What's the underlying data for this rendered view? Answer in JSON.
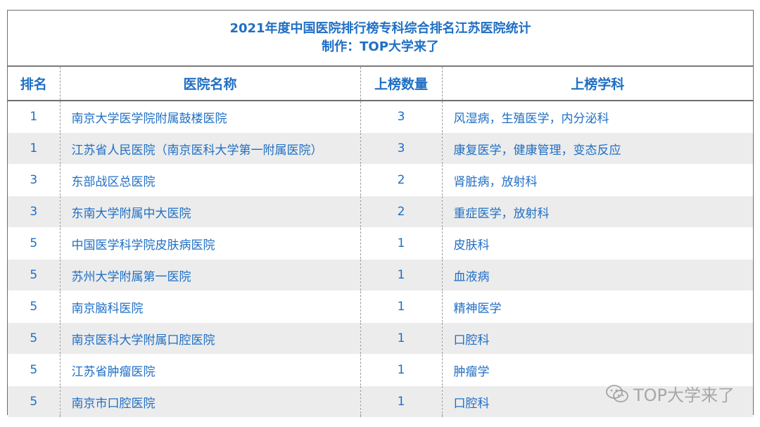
{
  "title": {
    "line1": "2021年度中国医院排行榜专科综合排名江苏医院统计",
    "line2": "制作：TOP大学来了"
  },
  "table": {
    "headers": [
      "排名",
      "医院名称",
      "上榜数量",
      "上榜学科"
    ],
    "rows": [
      {
        "rank": "1",
        "name": "南京大学医学院附属鼓楼医院",
        "count": "3",
        "subjects": "风湿病，生殖医学，内分泌科"
      },
      {
        "rank": "1",
        "name": "江苏省人民医院（南京医科大学第一附属医院）",
        "count": "3",
        "subjects": "康复医学，健康管理，变态反应"
      },
      {
        "rank": "3",
        "name": "东部战区总医院",
        "count": "2",
        "subjects": "肾脏病，放射科"
      },
      {
        "rank": "3",
        "name": "东南大学附属中大医院",
        "count": "2",
        "subjects": "重症医学，放射科"
      },
      {
        "rank": "5",
        "name": "中国医学科学院皮肤病医院",
        "count": "1",
        "subjects": "皮肤科"
      },
      {
        "rank": "5",
        "name": "苏州大学附属第一医院",
        "count": "1",
        "subjects": "血液病"
      },
      {
        "rank": "5",
        "name": "南京脑科医院",
        "count": "1",
        "subjects": "精神医学"
      },
      {
        "rank": "5",
        "name": "南京医科大学附属口腔医院",
        "count": "1",
        "subjects": "口腔科"
      },
      {
        "rank": "5",
        "name": "江苏省肿瘤医院",
        "count": "1",
        "subjects": "肿瘤学"
      },
      {
        "rank": "5",
        "name": "南京市口腔医院",
        "count": "1",
        "subjects": "口腔科"
      }
    ]
  },
  "watermark": {
    "icon": "wechat-icon",
    "text": "TOP大学来了"
  },
  "colors": {
    "text": "#1f6fc4",
    "stripe": "#ececec"
  }
}
